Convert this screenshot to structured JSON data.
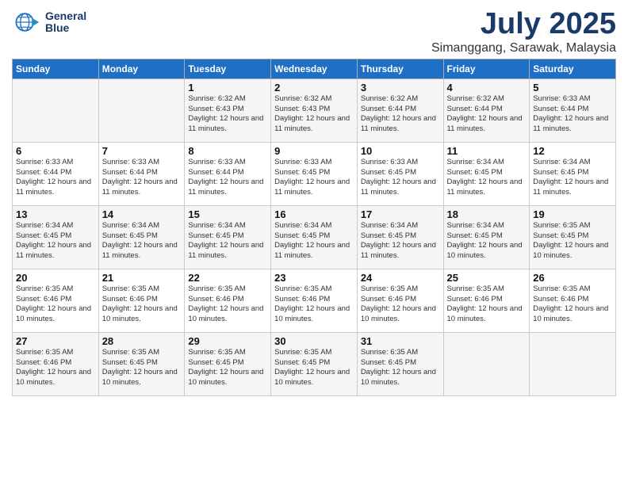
{
  "app": {
    "logo_line1": "General",
    "logo_line2": "Blue"
  },
  "header": {
    "month_year": "July 2025",
    "location": "Simanggang, Sarawak, Malaysia"
  },
  "days_of_week": [
    "Sunday",
    "Monday",
    "Tuesday",
    "Wednesday",
    "Thursday",
    "Friday",
    "Saturday"
  ],
  "weeks": [
    [
      {
        "day": "",
        "detail": ""
      },
      {
        "day": "",
        "detail": ""
      },
      {
        "day": "1",
        "detail": "Sunrise: 6:32 AM\nSunset: 6:43 PM\nDaylight: 12 hours\nand 11 minutes."
      },
      {
        "day": "2",
        "detail": "Sunrise: 6:32 AM\nSunset: 6:43 PM\nDaylight: 12 hours\nand 11 minutes."
      },
      {
        "day": "3",
        "detail": "Sunrise: 6:32 AM\nSunset: 6:44 PM\nDaylight: 12 hours\nand 11 minutes."
      },
      {
        "day": "4",
        "detail": "Sunrise: 6:32 AM\nSunset: 6:44 PM\nDaylight: 12 hours\nand 11 minutes."
      },
      {
        "day": "5",
        "detail": "Sunrise: 6:33 AM\nSunset: 6:44 PM\nDaylight: 12 hours\nand 11 minutes."
      }
    ],
    [
      {
        "day": "6",
        "detail": "Sunrise: 6:33 AM\nSunset: 6:44 PM\nDaylight: 12 hours\nand 11 minutes."
      },
      {
        "day": "7",
        "detail": "Sunrise: 6:33 AM\nSunset: 6:44 PM\nDaylight: 12 hours\nand 11 minutes."
      },
      {
        "day": "8",
        "detail": "Sunrise: 6:33 AM\nSunset: 6:44 PM\nDaylight: 12 hours\nand 11 minutes."
      },
      {
        "day": "9",
        "detail": "Sunrise: 6:33 AM\nSunset: 6:45 PM\nDaylight: 12 hours\nand 11 minutes."
      },
      {
        "day": "10",
        "detail": "Sunrise: 6:33 AM\nSunset: 6:45 PM\nDaylight: 12 hours\nand 11 minutes."
      },
      {
        "day": "11",
        "detail": "Sunrise: 6:34 AM\nSunset: 6:45 PM\nDaylight: 12 hours\nand 11 minutes."
      },
      {
        "day": "12",
        "detail": "Sunrise: 6:34 AM\nSunset: 6:45 PM\nDaylight: 12 hours\nand 11 minutes."
      }
    ],
    [
      {
        "day": "13",
        "detail": "Sunrise: 6:34 AM\nSunset: 6:45 PM\nDaylight: 12 hours\nand 11 minutes."
      },
      {
        "day": "14",
        "detail": "Sunrise: 6:34 AM\nSunset: 6:45 PM\nDaylight: 12 hours\nand 11 minutes."
      },
      {
        "day": "15",
        "detail": "Sunrise: 6:34 AM\nSunset: 6:45 PM\nDaylight: 12 hours\nand 11 minutes."
      },
      {
        "day": "16",
        "detail": "Sunrise: 6:34 AM\nSunset: 6:45 PM\nDaylight: 12 hours\nand 11 minutes."
      },
      {
        "day": "17",
        "detail": "Sunrise: 6:34 AM\nSunset: 6:45 PM\nDaylight: 12 hours\nand 11 minutes."
      },
      {
        "day": "18",
        "detail": "Sunrise: 6:34 AM\nSunset: 6:45 PM\nDaylight: 12 hours\nand 10 minutes."
      },
      {
        "day": "19",
        "detail": "Sunrise: 6:35 AM\nSunset: 6:45 PM\nDaylight: 12 hours\nand 10 minutes."
      }
    ],
    [
      {
        "day": "20",
        "detail": "Sunrise: 6:35 AM\nSunset: 6:46 PM\nDaylight: 12 hours\nand 10 minutes."
      },
      {
        "day": "21",
        "detail": "Sunrise: 6:35 AM\nSunset: 6:46 PM\nDaylight: 12 hours\nand 10 minutes."
      },
      {
        "day": "22",
        "detail": "Sunrise: 6:35 AM\nSunset: 6:46 PM\nDaylight: 12 hours\nand 10 minutes."
      },
      {
        "day": "23",
        "detail": "Sunrise: 6:35 AM\nSunset: 6:46 PM\nDaylight: 12 hours\nand 10 minutes."
      },
      {
        "day": "24",
        "detail": "Sunrise: 6:35 AM\nSunset: 6:46 PM\nDaylight: 12 hours\nand 10 minutes."
      },
      {
        "day": "25",
        "detail": "Sunrise: 6:35 AM\nSunset: 6:46 PM\nDaylight: 12 hours\nand 10 minutes."
      },
      {
        "day": "26",
        "detail": "Sunrise: 6:35 AM\nSunset: 6:46 PM\nDaylight: 12 hours\nand 10 minutes."
      }
    ],
    [
      {
        "day": "27",
        "detail": "Sunrise: 6:35 AM\nSunset: 6:46 PM\nDaylight: 12 hours\nand 10 minutes."
      },
      {
        "day": "28",
        "detail": "Sunrise: 6:35 AM\nSunset: 6:45 PM\nDaylight: 12 hours\nand 10 minutes."
      },
      {
        "day": "29",
        "detail": "Sunrise: 6:35 AM\nSunset: 6:45 PM\nDaylight: 12 hours\nand 10 minutes."
      },
      {
        "day": "30",
        "detail": "Sunrise: 6:35 AM\nSunset: 6:45 PM\nDaylight: 12 hours\nand 10 minutes."
      },
      {
        "day": "31",
        "detail": "Sunrise: 6:35 AM\nSunset: 6:45 PM\nDaylight: 12 hours\nand 10 minutes."
      },
      {
        "day": "",
        "detail": ""
      },
      {
        "day": "",
        "detail": ""
      }
    ]
  ]
}
